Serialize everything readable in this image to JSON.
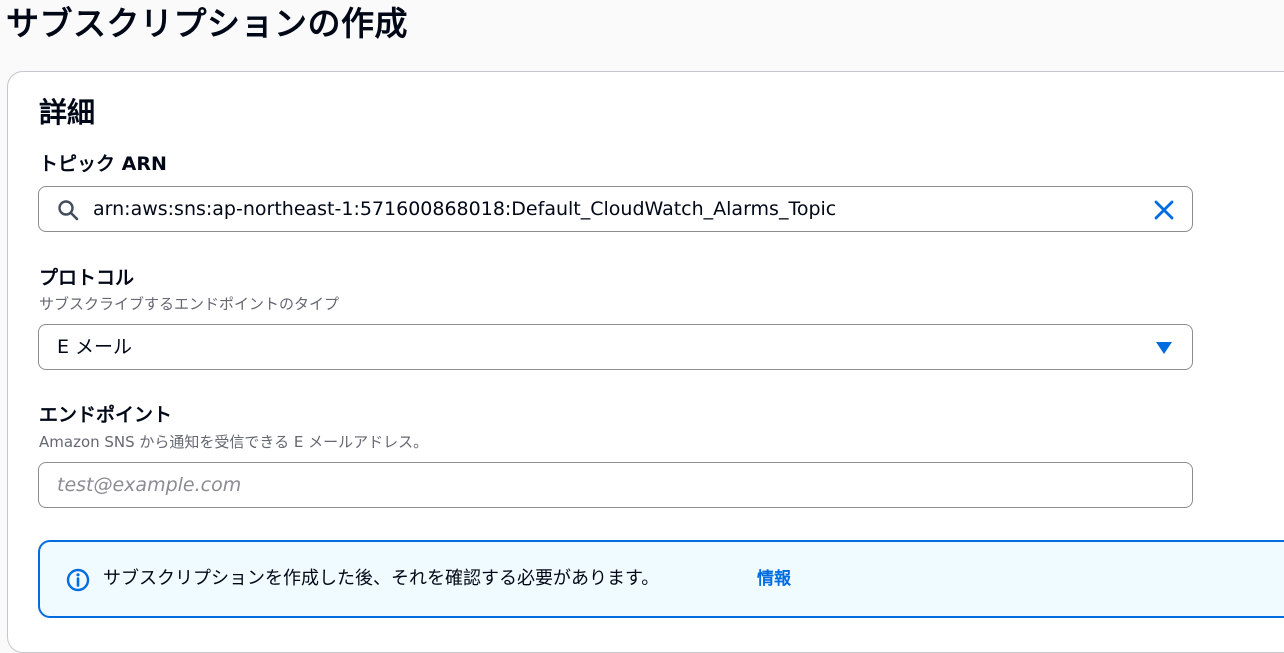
{
  "page": {
    "title": "サブスクリプションの作成"
  },
  "details": {
    "section_title": "詳細",
    "topic_arn": {
      "label": "トピック ARN",
      "value": "arn:aws:sns:ap-northeast-1:571600868018:Default_CloudWatch_Alarms_Topic"
    },
    "protocol": {
      "label": "プロトコル",
      "description": "サブスクライブするエンドポイントのタイプ",
      "selected": "E メール"
    },
    "endpoint": {
      "label": "エンドポイント",
      "description": "Amazon SNS から通知を受信できる E メールアドレス。",
      "placeholder": "test@example.com"
    },
    "alert": {
      "message": "サブスクリプションを作成した後、それを確認する必要があります。",
      "link": "情報"
    }
  },
  "icons": {
    "search": "search-icon",
    "clear": "close-icon",
    "dropdown": "caret-down-icon",
    "info": "info-icon"
  },
  "colors": {
    "accent": "#006ce0",
    "border": "#8c8c94",
    "alert_bg": "#f0fbff",
    "text": "#000716",
    "muted": "#656871"
  }
}
